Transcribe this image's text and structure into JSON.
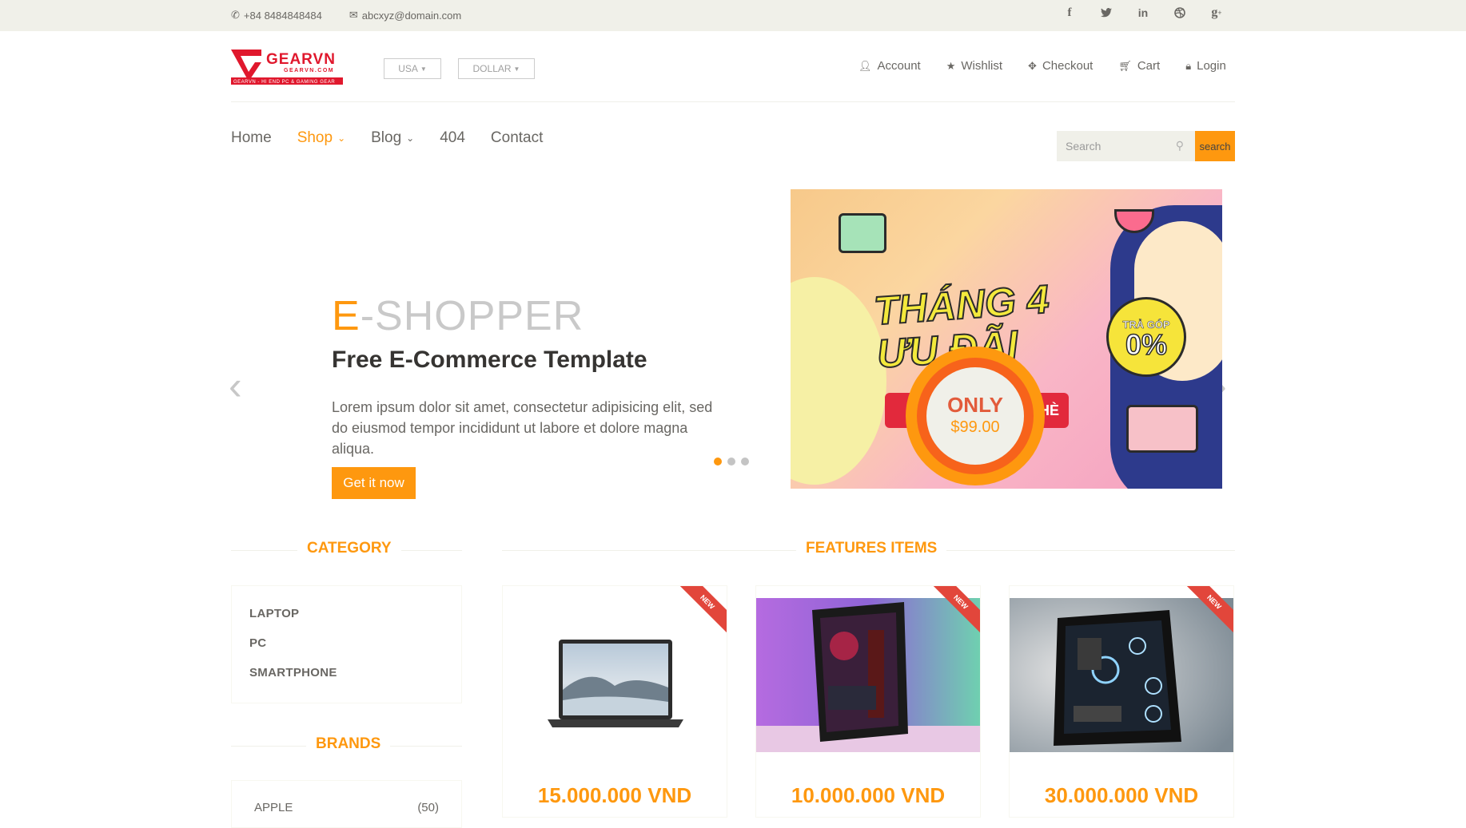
{
  "topbar": {
    "phone": "+84 8484848484",
    "email": "abcxyz@domain.com",
    "social": [
      "f",
      "t",
      "in",
      "dribbble",
      "g+"
    ]
  },
  "header": {
    "logo_text": "GEARVN",
    "logo_sub": "GEARVN.COM",
    "logo_tag": "GEARVN - HI END PC & GAMING GEAR",
    "country": "USA",
    "currency": "DOLLAR",
    "account_menu": [
      "Account",
      "Wishlist",
      "Checkout",
      "Cart",
      "Login"
    ]
  },
  "nav": {
    "items": [
      "Home",
      "Shop",
      "Blog",
      "404",
      "Contact"
    ],
    "active": "Shop"
  },
  "search": {
    "placeholder": "Search",
    "button": "search"
  },
  "hero": {
    "brand_first": "E",
    "brand_rest": "-SHOPPER",
    "title": "Free E-Commerce Template",
    "text": "Lorem ipsum dolor sit amet, consectetur adipisicing elit, sed do eiusmod tempor incididunt ut labore et dolore magna aliqua.",
    "button": "Get it now",
    "banner_headline_1": "THÁNG 4",
    "banner_headline_2": "ƯU ĐÃI",
    "banner_strip": "HÈ",
    "banner_badge_top": "TRẢ GÓP",
    "banner_badge_main": "0%",
    "price_only": "ONLY",
    "price_value": "$99.00",
    "slide_count": 3,
    "active_slide": 1
  },
  "category": {
    "title": "CATEGORY",
    "items": [
      "LAPTOP",
      "PC",
      "SMARTPHONE"
    ]
  },
  "brands": {
    "title": "BRANDS",
    "items": [
      {
        "name": "APPLE",
        "count": "(50)"
      }
    ]
  },
  "features": {
    "title": "FEATURES ITEMS",
    "products": [
      {
        "price": "15.000.000 VND",
        "ribbon": "NEW",
        "image": "laptop"
      },
      {
        "price": "10.000.000 VND",
        "ribbon": "NEW",
        "image": "pc-case-purple"
      },
      {
        "price": "30.000.000 VND",
        "ribbon": "NEW",
        "image": "pc-case-black"
      }
    ]
  },
  "colors": {
    "accent": "#fe980f",
    "text": "#696763",
    "topbar": "#f0f0e9"
  }
}
